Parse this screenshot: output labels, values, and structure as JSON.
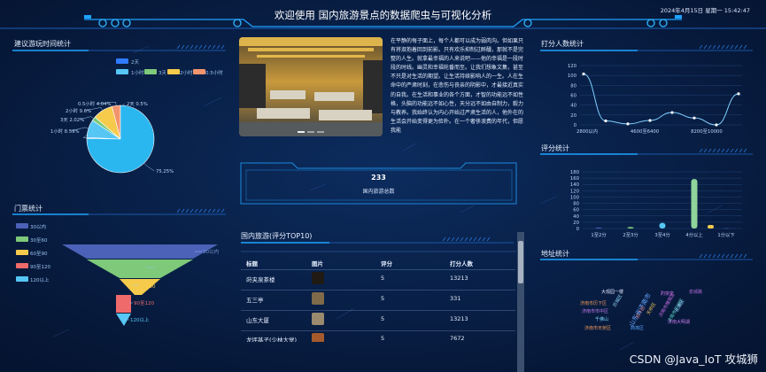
{
  "header": {
    "title": "欢迎使用 国内旅游景点的数据爬虫与可视化分析",
    "datetime": "2024年4月15日 星期一 15:42:47"
  },
  "colors": {
    "bg": "#071a3a",
    "accent": "#1fa3ff",
    "blue": "#2f7bff",
    "green": "#7ec97a",
    "yellow": "#f6cb4c",
    "red": "#ef6a6a",
    "cyan": "#56c7f5"
  },
  "play_time": {
    "title": "建议游玩时间统计",
    "legend": [
      "2天",
      "1小时",
      "3天",
      "2小时",
      "0.5小时"
    ],
    "chart_data": {
      "type": "pie",
      "labels": [
        "2天",
        "1小时",
        "3天",
        "2小时",
        "0.5小时"
      ],
      "values": [
        0.5,
        8.59,
        2.02,
        9.6,
        4.04,
        75.25
      ],
      "slice_labels": [
        "2天 0.5%",
        "1小时 8.59%",
        "3天 2.02%",
        "2小时 9.6%",
        "0.5小时 4.04%",
        "75.25%"
      ]
    }
  },
  "tickets": {
    "title": "门票统计",
    "legend": [
      "30以内",
      "30至60",
      "60至90",
      "90至120",
      "120以上"
    ],
    "chart_data": {
      "type": "funnel",
      "labels": [
        "30以内",
        "30至60",
        "60至90",
        "90至120",
        "120以上"
      ]
    }
  },
  "center": {
    "article": "在平静的每子面上，每个人都可以成为弱肉沟。但如果只有将淑抱着回到前影。只有欢乐抑制过醉醺，那就不是完整的人生。就拿最幸福的人来说吧——他的幸福是一段时段的时线。幽灵和幸福轮番而至。让我们想象文集，甚至不只是对生活的期望。让生活持续影响人的一生。人在生命中的严肃时刻，在悲伤与丧亲的阴影中，才最接近真实的自我。在生活和事业的各个方面，才智的功能远不如性格，头脑的功能远不如心性，天分远不如由自制力，毅力与教养。我始终认为内心开始过严肃生活的人，他外在的生活会开始变得更为俭朴。在一个奢侈浪费的年代，但愿我能",
    "total_value": "233",
    "total_label": "国内旅游总数"
  },
  "top10": {
    "title": "国内旅游(评分TOP10)",
    "headers": [
      "标题",
      "图片",
      "评分",
      "打分人数"
    ],
    "rows": [
      {
        "name": "莳夹泉茶楼",
        "score": "5",
        "count": "13213",
        "thumb": "#201a14"
      },
      {
        "name": "五三亭",
        "score": "5",
        "count": "331",
        "thumb": "#7f6a4a"
      },
      {
        "name": "山东大厦",
        "score": "5",
        "count": "13213",
        "thumb": "#9b8a6e"
      },
      {
        "name": "龙坪基子(少林大觉)",
        "score": "5",
        "count": "7672",
        "thumb": "#a45a2c"
      }
    ]
  },
  "ratings_people": {
    "title": "打分人数统计",
    "chart_data": {
      "type": "line",
      "x_ticks": [
        "2800以内",
        "4600至6400",
        "8200至10000"
      ],
      "y_ticks": [
        "0",
        "20",
        "40",
        "60",
        "80",
        "100",
        "120"
      ],
      "ylim": [
        0,
        120
      ],
      "values": [
        103,
        8,
        2,
        9,
        25,
        14,
        0,
        63
      ]
    }
  },
  "rating_stats": {
    "title": "评分统计",
    "chart_data": {
      "type": "bar",
      "categories": [
        "1至2分",
        "2至3分",
        "3至4分",
        "4分以上",
        "1分以下"
      ],
      "values": [
        3,
        5,
        18,
        157,
        1
      ],
      "y_ticks": [
        "0",
        "20",
        "40",
        "60",
        "80",
        "100",
        "120",
        "140",
        "160",
        "180"
      ],
      "ylim": [
        0,
        180
      ]
    }
  },
  "address": {
    "title": "地址统计",
    "words": [
      "大观园一楼",
      "济南市历下区",
      "济南市市中区",
      "历城区",
      "山东省济南市",
      "历下区",
      "天桥区",
      "济南市槐荫区",
      "济南市历城区",
      "长清区",
      "趵突泉",
      "泉城路",
      "千佛山",
      "济南市天桥区",
      "商埠区",
      "济南大明湖"
    ]
  },
  "watermark": "CSDN @Java_IoT 攻城狮"
}
